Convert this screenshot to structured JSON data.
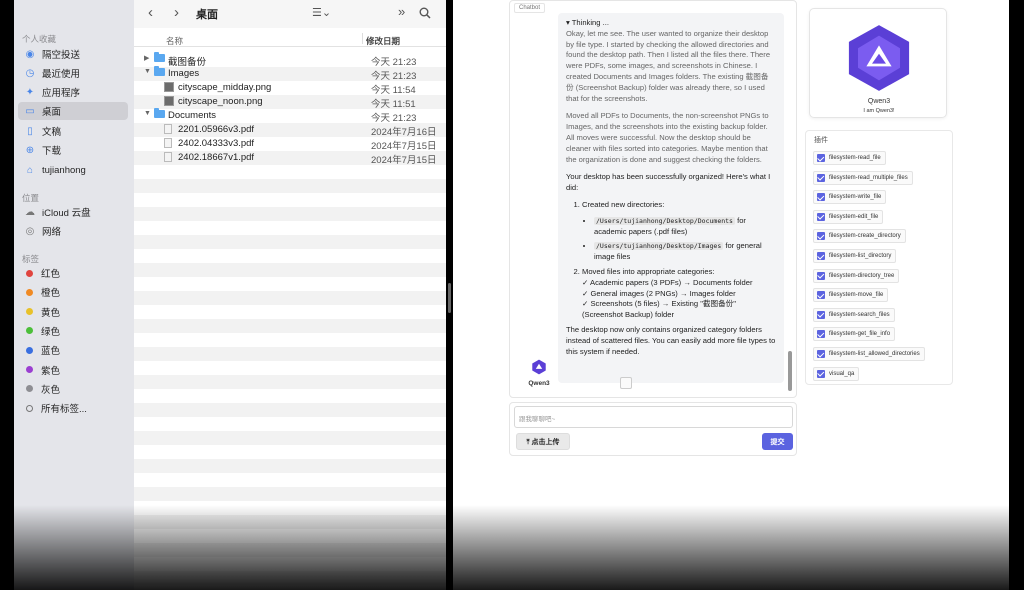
{
  "finder": {
    "sidebar": {
      "section_favorites": "个人收藏",
      "favorites": [
        {
          "label": "隔空投送",
          "icon": "airdrop-icon"
        },
        {
          "label": "最近使用",
          "icon": "clock-icon"
        },
        {
          "label": "应用程序",
          "icon": "applications-icon"
        },
        {
          "label": "桌面",
          "icon": "desktop-icon",
          "selected": true
        },
        {
          "label": "文稿",
          "icon": "document-icon"
        },
        {
          "label": "下载",
          "icon": "download-icon"
        },
        {
          "label": "tujianhong",
          "icon": "home-icon"
        }
      ],
      "section_locations": "位置",
      "locations": [
        {
          "label": "iCloud 云盘",
          "icon": "cloud-icon"
        },
        {
          "label": "网络",
          "icon": "network-icon"
        }
      ],
      "section_tags": "标签",
      "tags": [
        {
          "label": "红色",
          "color": "#e0443e"
        },
        {
          "label": "橙色",
          "color": "#f08a24"
        },
        {
          "label": "黄色",
          "color": "#e8c12a"
        },
        {
          "label": "绿色",
          "color": "#4cbf3a"
        },
        {
          "label": "蓝色",
          "color": "#3a6fe0"
        },
        {
          "label": "紫色",
          "color": "#9b3fd1"
        },
        {
          "label": "灰色",
          "color": "#8e8e93"
        },
        {
          "label": "所有标签...",
          "color": ""
        }
      ]
    },
    "toolbar": {
      "title": "桌面",
      "back": "‹",
      "forward": "›",
      "more": "»"
    },
    "columns": {
      "name": "名称",
      "date": "修改日期"
    },
    "files": [
      {
        "name": "截图备份",
        "date": "今天 21:23",
        "type": "folder",
        "level": 0,
        "expanded": false
      },
      {
        "name": "Images",
        "date": "今天 21:23",
        "type": "folder",
        "level": 0,
        "expanded": true
      },
      {
        "name": "cityscape_midday.png",
        "date": "今天 11:54",
        "type": "image",
        "level": 1
      },
      {
        "name": "cityscape_noon.png",
        "date": "今天 11:51",
        "type": "image",
        "level": 1
      },
      {
        "name": "Documents",
        "date": "今天 21:23",
        "type": "folder",
        "level": 0,
        "expanded": true
      },
      {
        "name": "2201.05966v3.pdf",
        "date": "2024年7月16日",
        "type": "pdf",
        "level": 1
      },
      {
        "name": "2402.04333v3.pdf",
        "date": "2024年7月15日",
        "type": "pdf",
        "level": 1
      },
      {
        "name": "2402.18667v1.pdf",
        "date": "2024年7月15日",
        "type": "pdf",
        "level": 1
      }
    ]
  },
  "chat": {
    "label": "Chatbot",
    "thinking_title": "▾ Thinking ...",
    "thinking_p1": "Okay, let me see. The user wanted to organize their desktop by file type. I started by checking the allowed directories and found the desktop path. Then I listed all the files there. There were PDFs, some images, and screenshots in Chinese. I created Documents and Images folders. The existing 截图备份 (Screenshot Backup) folder was already there, so I used that for the screenshots.",
    "thinking_p2": "Moved all PDFs to Documents, the non-screenshot PNGs to Images, and the screenshots into the existing backup folder. All moves were successful. Now the desktop should be cleaner with files sorted into categories. Maybe mention that the organization is done and suggest checking the folders.",
    "answer_intro": "Your desktop has been successfully organized! Here's what I did:",
    "step1_title": "Created new directories:",
    "step1_items": [
      {
        "code": "/Users/tujianhong/Desktop/Documents",
        "text": " for academic papers (.pdf files)"
      },
      {
        "code": "/Users/tujianhong/Desktop/Images",
        "text": " for general image files"
      }
    ],
    "step2_title": "Moved files into appropriate categories:",
    "step2_lines": [
      "✓ Academic papers (3 PDFs) → Documents folder",
      "✓ General images (2 PNGs) → Images folder",
      "✓ Screenshots (5 files) → Existing \"截图备份\" (Screenshot Backup) folder"
    ],
    "answer_outro": "The desktop now only contains organized category folders instead of scattered files. You can easily add more file types to this system if needed.",
    "avatar_label": "Qwen3",
    "input_placeholder": "跟我聊聊吧~",
    "upload_label": "⤒ 点击上传",
    "submit_label": "提交"
  },
  "profile": {
    "name": "Qwen3",
    "caption": "I am Qwen3!",
    "brand_color": "#5b3fd6"
  },
  "plugins": {
    "label": "插件",
    "items": [
      "filesystem-read_file",
      "filesystem-read_multiple_files",
      "filesystem-write_file",
      "filesystem-edit_file",
      "filesystem-create_directory",
      "filesystem-list_directory",
      "filesystem-directory_tree",
      "filesystem-move_file",
      "filesystem-search_files",
      "filesystem-get_file_info",
      "filesystem-list_allowed_directories",
      "visual_qa"
    ]
  }
}
